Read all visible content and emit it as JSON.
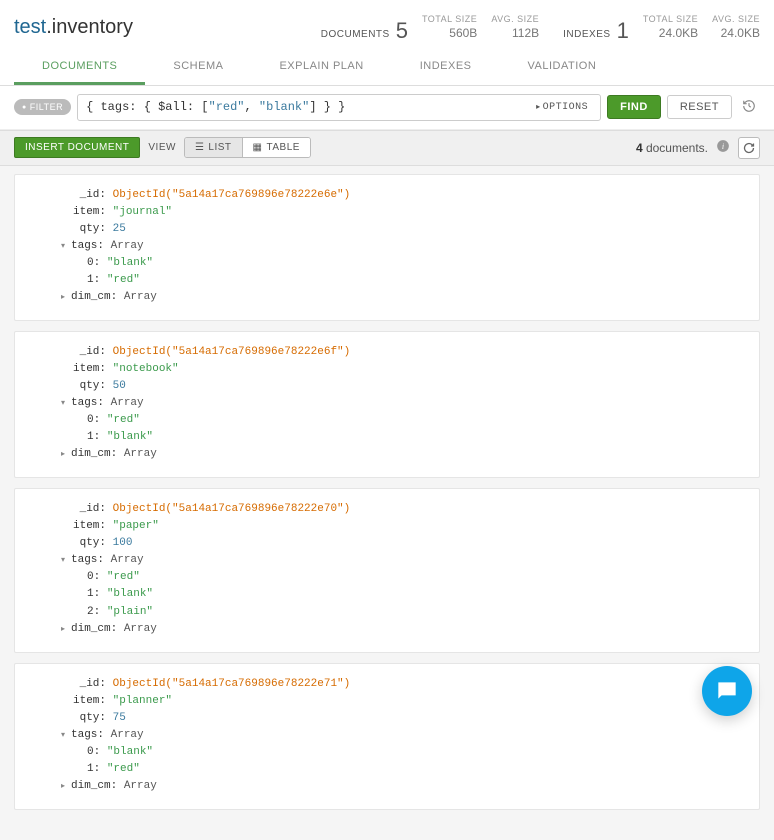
{
  "namespace": {
    "db": "test",
    "coll": ".inventory"
  },
  "stats": {
    "documents_label": "DOCUMENTS",
    "documents": "5",
    "total_size_label": "TOTAL SIZE",
    "total_size": "560B",
    "avg_size_label": "AVG. SIZE",
    "avg_size": "112B",
    "indexes_label": "INDEXES",
    "indexes": "1",
    "idx_total_size_label": "TOTAL SIZE",
    "idx_total_size": "24.0KB",
    "idx_avg_size_label": "AVG. SIZE",
    "idx_avg_size": "24.0KB"
  },
  "tabs": {
    "documents": "DOCUMENTS",
    "schema": "SCHEMA",
    "explain": "EXPLAIN PLAN",
    "indexes": "INDEXES",
    "validation": "VALIDATION"
  },
  "filter": {
    "pill": "FILTER",
    "query_parts": [
      "{ tags: { $all: [",
      "\"red\"",
      ", ",
      "\"blank\"",
      "] } }"
    ],
    "options": "OPTIONS",
    "find": "FIND",
    "reset": "RESET"
  },
  "toolbar": {
    "insert": "INSERT DOCUMENT",
    "view": "VIEW",
    "list": "LIST",
    "table": "TABLE",
    "count_num": "4",
    "count_text": " documents."
  },
  "documents": [
    {
      "_id": "ObjectId(\"5a14a17ca769896e78222e6e\")",
      "item": "\"journal\"",
      "qty": "25",
      "tags": [
        "\"blank\"",
        "\"red\""
      ],
      "dim_cm": "Array"
    },
    {
      "_id": "ObjectId(\"5a14a17ca769896e78222e6f\")",
      "item": "\"notebook\"",
      "qty": "50",
      "tags": [
        "\"red\"",
        "\"blank\""
      ],
      "dim_cm": "Array"
    },
    {
      "_id": "ObjectId(\"5a14a17ca769896e78222e70\")",
      "item": "\"paper\"",
      "qty": "100",
      "tags": [
        "\"red\"",
        "\"blank\"",
        "\"plain\""
      ],
      "dim_cm": "Array"
    },
    {
      "_id": "ObjectId(\"5a14a17ca769896e78222e71\")",
      "item": "\"planner\"",
      "qty": "75",
      "tags": [
        "\"blank\"",
        "\"red\""
      ],
      "dim_cm": "Array"
    }
  ]
}
